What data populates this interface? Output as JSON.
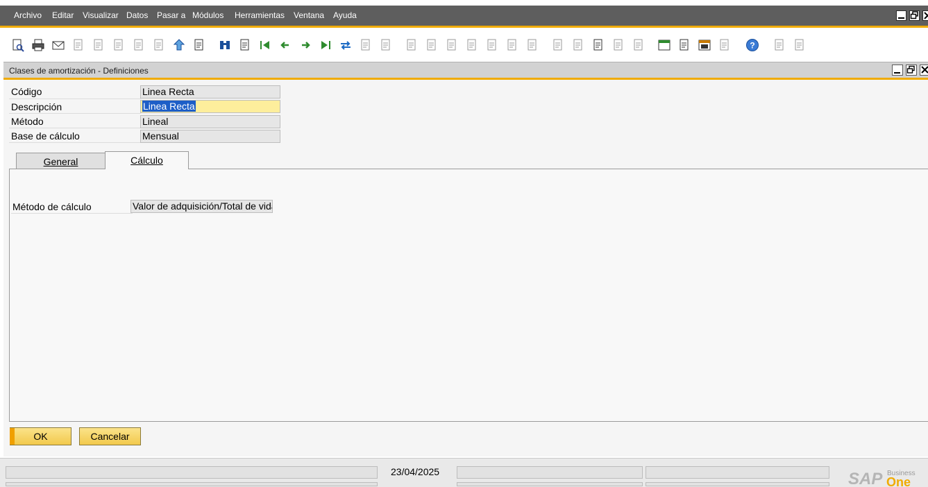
{
  "menu": {
    "items": [
      "Archivo",
      "Editar",
      "Visualizar",
      "Datos",
      "Pasar a",
      "Módulos",
      "Herramientas",
      "Ventana",
      "Ayuda"
    ]
  },
  "toolbar": {
    "icons": [
      "preview-icon",
      "print-icon",
      "email-icon",
      "export-icon",
      "fax-icon",
      "excel-icon",
      "word-icon",
      "pdf-icon",
      "launch-icon",
      "lock-icon",
      "find-icon",
      "add-icon",
      "first-record-icon",
      "previous-record-icon",
      "next-record-icon",
      "last-record-icon",
      "refresh-icon",
      "filter-icon",
      "sort-icon",
      "base-document-icon",
      "target-document-icon",
      "relationship-map-icon",
      "gross-profit-icon",
      "volume-icon",
      "journal-icon",
      "settings-icon",
      "edit-icon",
      "form-settings-icon",
      "query-icon",
      "message-icon",
      "alert-icon",
      "calendar-icon",
      "mail-icon",
      "dashboard-icon",
      "tree-icon",
      "help-icon",
      "tools-icon",
      "report-icon"
    ]
  },
  "window": {
    "title": "Clases de amortización - Definiciones"
  },
  "form": {
    "codigo_label": "Código",
    "codigo_value": "Linea Recta",
    "descripcion_label": "Descripción",
    "descripcion_value": "Linea Recta",
    "metodo_label": "Método",
    "metodo_value": "Lineal",
    "base_label": "Base de cálculo",
    "base_value": "Mensual"
  },
  "tabs": {
    "general": "General",
    "calculo": "Cálculo"
  },
  "calculo": {
    "metodo_calculo_label": "Método de cálculo",
    "metodo_calculo_value": "Valor de adquisición/Total de vida"
  },
  "buttons": {
    "ok": "OK",
    "cancel": "Cancelar"
  },
  "status": {
    "date": "23/04/2025",
    "brand_sap": "SAP",
    "brand_business": "Business",
    "brand_one": "One"
  },
  "colors": {
    "accent": "#f0ab00",
    "menubar": "#5e5e5e",
    "active_field": "#fdee9c",
    "selection": "#1d5ec7"
  }
}
